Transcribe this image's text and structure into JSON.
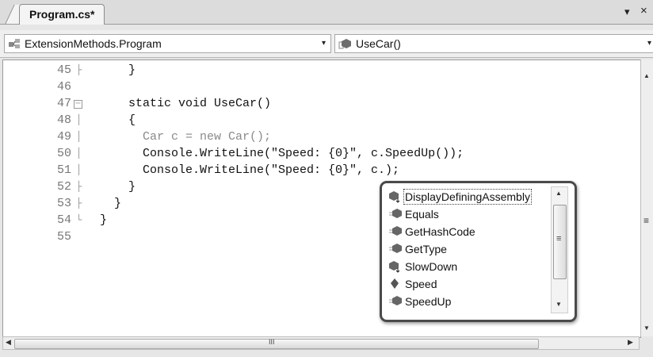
{
  "tab": {
    "title": "Program.cs*",
    "menu_arrow": "▾",
    "close": "×"
  },
  "nav": {
    "type_combo": "ExtensionMethods.Program",
    "member_combo": "UseCar()",
    "combo_arrow": "▾"
  },
  "editor": {
    "lines": [
      {
        "num": "45",
        "code": "    }"
      },
      {
        "num": "46",
        "code": ""
      },
      {
        "num": "47",
        "code": "    static void UseCar()"
      },
      {
        "num": "48",
        "code": "    {"
      },
      {
        "num": "49",
        "code": "      Car c = new Car();"
      },
      {
        "num": "50",
        "code": "      Console.WriteLine(\"Speed: {0}\", c.SpeedUp());"
      },
      {
        "num": "51",
        "code": "      Console.WriteLine(\"Speed: {0}\", c.);"
      },
      {
        "num": "52",
        "code": "    }"
      },
      {
        "num": "53",
        "code": "  }"
      },
      {
        "num": "54",
        "code": "}"
      },
      {
        "num": "55",
        "code": ""
      }
    ]
  },
  "intellisense": {
    "items": [
      {
        "label": "DisplayDefiningAssembly",
        "icon": "extension-method-icon",
        "selected": true
      },
      {
        "label": "Equals",
        "icon": "method-icon"
      },
      {
        "label": "GetHashCode",
        "icon": "method-icon"
      },
      {
        "label": "GetType",
        "icon": "method-icon"
      },
      {
        "label": "SlowDown",
        "icon": "extension-method-icon"
      },
      {
        "label": "Speed",
        "icon": "field-icon"
      },
      {
        "label": "SpeedUp",
        "icon": "method-icon"
      }
    ]
  },
  "scrollbars": {
    "up": "▲",
    "down": "▼",
    "left": "◀",
    "right": "▶",
    "grip": "≡",
    "hgrip": "III"
  }
}
